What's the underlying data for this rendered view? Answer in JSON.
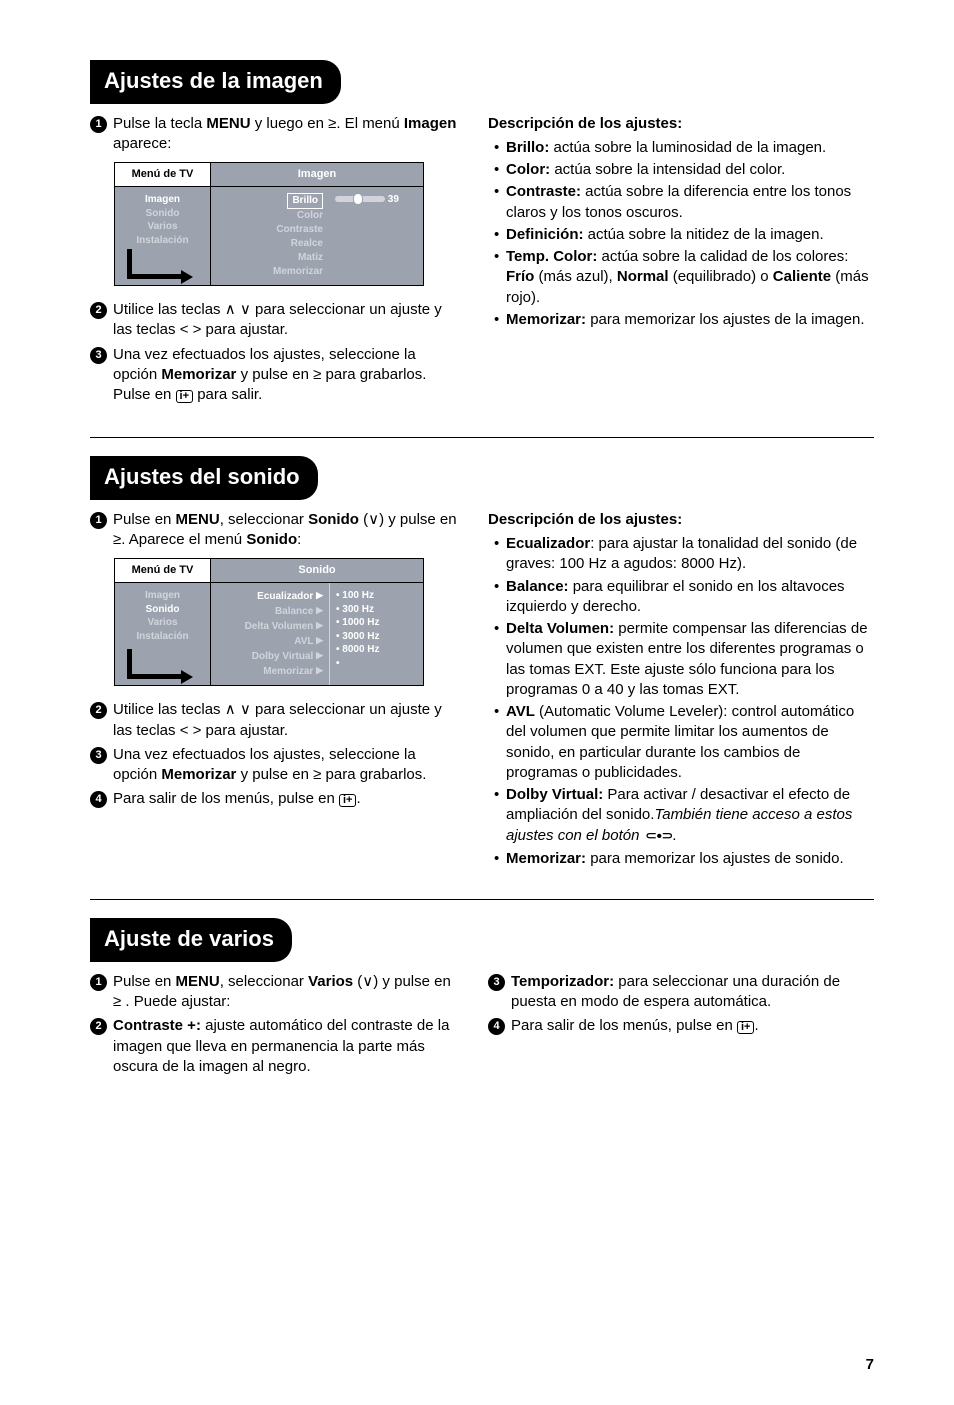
{
  "sections": {
    "imagen": {
      "title": "Ajustes de la imagen",
      "step1_a": "Pulse la tecla ",
      "step1_menu": "MENU",
      "step1_b": " y luego en ≥. El menú ",
      "step1_c": "Imagen",
      "step1_d": " aparece:",
      "osd": {
        "head_left": "Menú de TV",
        "head_right": "Imagen",
        "left_items": [
          "Imagen",
          "Sonido",
          "Varios",
          "Instalación"
        ],
        "right_items": [
          "Brillo",
          "Color",
          "Contraste",
          "Realce",
          "Matiz",
          "Memorizar"
        ],
        "value_label": "39"
      },
      "step2": "Utilice las teclas  ∧ ∨  para seleccionar un ajuste y las teclas  < >  para ajustar.",
      "step3_a": "Una vez efectuados los ajustes, seleccione la opción ",
      "step3_mem": "Memorizar",
      "step3_b": " y pulse en  ≥  para grabarlos. Pulse en ",
      "step3_c": " para salir.",
      "desc_head": "Descripción de los ajustes:",
      "bullets": [
        [
          "Brillo:",
          " actúa sobre la luminosidad de la imagen."
        ],
        [
          "Color:",
          " actúa sobre la intensidad del color."
        ],
        [
          "Contraste:",
          " actúa sobre la diferencia entre los tonos claros y los tonos oscuros."
        ],
        [
          "Definición:",
          " actúa sobre la nitidez de la imagen."
        ],
        [
          "Temp. Color:",
          " actúa sobre la calidad de los colores: ",
          "Frío",
          " (más azul), ",
          "Normal",
          " (equilibrado) o ",
          "Caliente",
          " (más rojo)."
        ],
        [
          "Memorizar:",
          " para memorizar los ajustes de la imagen."
        ]
      ]
    },
    "sonido": {
      "title": "Ajustes del sonido",
      "step1_a": "Pulse en ",
      "step1_menu": "MENU",
      "step1_b": ", seleccionar ",
      "step1_son": "Sonido",
      "step1_c": " (∨) y pulse en ≥. Aparece el menú ",
      "step1_d": "Sonido",
      "step1_e": ":",
      "osd": {
        "head_left": "Menú de TV",
        "head_right": "Sonido",
        "left_items": [
          "Imagen",
          "Sonido",
          "Varios",
          "Instalación"
        ],
        "right_items": [
          "Ecualizador",
          "Balance",
          "Delta Volumen",
          "AVL",
          "Dolby Virtual",
          "Memorizar"
        ],
        "values": [
          "100 Hz",
          "300 Hz",
          "1000 Hz",
          "3000 Hz",
          "8000 Hz",
          ""
        ]
      },
      "step2": "Utilice las teclas  ∧ ∨  para seleccionar un ajuste y las teclas  < >  para ajustar.",
      "step3_a": "Una vez efectuados los ajustes, seleccione la opción ",
      "step3_mem": "Memorizar",
      "step3_b": " y pulse en  ≥  para grabarlos.",
      "step4_a": "Para salir de los menús, pulse en ",
      "step4_b": ".",
      "desc_head": "Descripción de los ajustes:",
      "bullets": [
        [
          "Ecualizador",
          ": para ajustar la tonalidad del sonido (de graves: 100 Hz a agudos: 8000 Hz)."
        ],
        [
          "Balance:",
          " para equilibrar el sonido en los altavoces izquierdo y derecho."
        ],
        [
          "Delta Volumen:",
          " permite compensar las diferencias de volumen que existen entre los diferentes programas o las tomas EXT. Este ajuste sólo funciona para los programas 0 a 40 y las tomas EXT."
        ],
        [
          "AVL",
          " (Automatic Volume Leveler): control automático del volumen que permite limitar los aumentos de sonido, en particular durante los cambios de programas o publicidades."
        ],
        [
          "Dolby Virtual:",
          " Para activar / desactivar el efecto de ampliación del sonido."
        ],
        [
          "Memorizar:",
          " para memorizar los ajustes de sonido."
        ]
      ],
      "italic": "También tiene acceso a estos ajustes con el botón "
    },
    "varios": {
      "title": "Ajuste de varios",
      "step1_a": "Pulse en ",
      "step1_menu": "MENU",
      "step1_b": ", seleccionar ",
      "step1_var": "Varios",
      "step1_c": " (∨) y pulse en  ≥ . Puede ajustar:",
      "step2_a": "Contraste +:",
      "step2_b": " ajuste automático del contraste de la imagen que lleva en permanencia la parte más oscura de la imagen al negro.",
      "step3_a": "Temporizador:",
      "step3_b": " para seleccionar una duración de puesta en modo de espera automática.",
      "step4_a": "Para salir de los menús, pulse en ",
      "step4_b": "."
    }
  },
  "iplus": "i+",
  "page": "7"
}
